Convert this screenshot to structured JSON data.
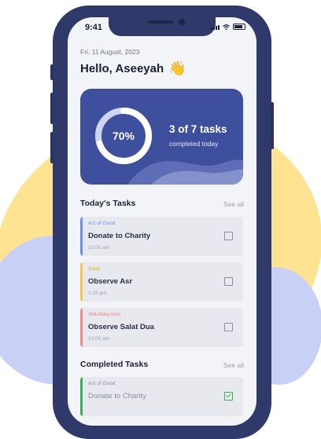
{
  "status_bar": {
    "time": "9:41"
  },
  "header": {
    "date": "Fri, 11 August, 2023",
    "greeting": "Hello, Aseeyah",
    "wave_icon": "waving-hand-icon"
  },
  "progress": {
    "percent_label": "70%",
    "percent_value": 0.7,
    "tasks_label": "3 of 7 tasks",
    "subtitle": "completed today",
    "card_color": "#3e4f9d"
  },
  "todays_tasks": {
    "title": "Today's Tasks",
    "see_all": "See all",
    "items": [
      {
        "category": "Act of Good",
        "name": "Donate to Charity",
        "time": "10:00 am",
        "color": "#6f8df0"
      },
      {
        "category": "Salat",
        "name": "Observe Asr",
        "time": "1:15 pm",
        "color": "#f4c64b"
      },
      {
        "category": "Voluntary Acts",
        "name": "Observe Salat Dua",
        "time": "10:00 am",
        "color": "#f08b8b"
      }
    ]
  },
  "completed_tasks": {
    "title": "Completed Tasks",
    "see_all": "See all",
    "items": [
      {
        "category": "Act of Good",
        "name": "Donate to Charity",
        "color": "#3caa5c"
      }
    ]
  }
}
